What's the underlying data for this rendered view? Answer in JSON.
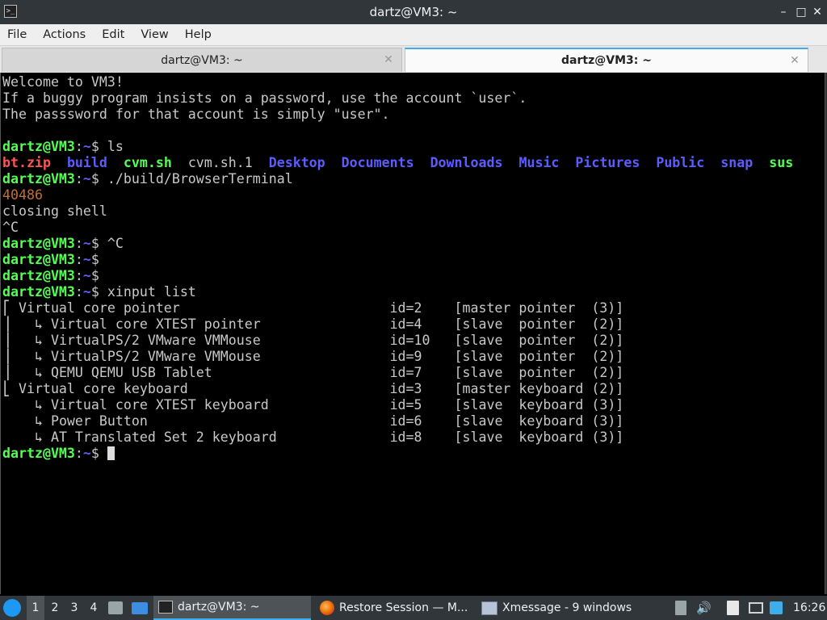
{
  "window": {
    "title": "dartz@VM3: ~",
    "app_icon": "terminal-icon",
    "app_icon_glyph": ">_",
    "minimize_glyph": "–",
    "maximize_glyph": "□",
    "close_glyph": "✕"
  },
  "menu": {
    "file": "File",
    "actions": "Actions",
    "edit": "Edit",
    "view": "View",
    "help": "Help"
  },
  "tabs": [
    {
      "label": "dartz@VM3: ~",
      "active": false,
      "close_glyph": "✕"
    },
    {
      "label": "dartz@VM3: ~",
      "active": true,
      "close_glyph": "✕"
    }
  ],
  "terminal": {
    "prompt_user": "dartz@VM3",
    "prompt_sep": ":",
    "prompt_path": "~",
    "prompt_dollar": "$ ",
    "welcome": [
      "Welcome to VM3!",
      "If a buggy program insists on a password, use the account `user`.",
      "The passsword for that account is simply \"user\"."
    ],
    "cmd_ls": "ls",
    "ls_items": [
      {
        "name": "bt.zip",
        "color": "#ff5454"
      },
      {
        "name": "build",
        "color": "#5c5cff"
      },
      {
        "name": "cvm.sh",
        "color": "#54ff54"
      },
      {
        "name": "cvm.sh.1",
        "color": "#c8c8c8"
      },
      {
        "name": "Desktop",
        "color": "#5c5cff"
      },
      {
        "name": "Documents",
        "color": "#5c5cff"
      },
      {
        "name": "Downloads",
        "color": "#5c5cff"
      },
      {
        "name": "Music",
        "color": "#5c5cff"
      },
      {
        "name": "Pictures",
        "color": "#5c5cff"
      },
      {
        "name": "Public",
        "color": "#5c5cff"
      },
      {
        "name": "snap",
        "color": "#5c5cff"
      },
      {
        "name": "sus",
        "color": "#54ff54"
      }
    ],
    "cmd_browser": "./build/BrowserTerminal",
    "pid": "40486",
    "closing": "closing shell",
    "ctrl_c": "^C",
    "cmd_ctrlc": "^C",
    "cmd_xinput": "xinput list",
    "xinput": [
      {
        "tree": "⎡ ",
        "name": "Virtual core pointer",
        "id": "id=2",
        "desc": "[master pointer  (3)]"
      },
      {
        "tree": "⎥   ↳ ",
        "name": "Virtual core XTEST pointer",
        "id": "id=4",
        "desc": "[slave  pointer  (2)]"
      },
      {
        "tree": "⎥   ↳ ",
        "name": "VirtualPS/2 VMware VMMouse",
        "id": "id=10",
        "desc": "[slave  pointer  (2)]"
      },
      {
        "tree": "⎥   ↳ ",
        "name": "VirtualPS/2 VMware VMMouse",
        "id": "id=9",
        "desc": "[slave  pointer  (2)]"
      },
      {
        "tree": "⎥   ↳ ",
        "name": "QEMU QEMU USB Tablet",
        "id": "id=7",
        "desc": "[slave  pointer  (2)]"
      },
      {
        "tree": "⎣ ",
        "name": "Virtual core keyboard",
        "id": "id=3",
        "desc": "[master keyboard (2)]"
      },
      {
        "tree": "    ↳ ",
        "name": "Virtual core XTEST keyboard",
        "id": "id=5",
        "desc": "[slave  keyboard (3)]"
      },
      {
        "tree": "    ↳ ",
        "name": "Power Button",
        "id": "id=6",
        "desc": "[slave  keyboard (3)]"
      },
      {
        "tree": "    ↳ ",
        "name": "AT Translated Set 2 keyboard",
        "id": "id=8",
        "desc": "[slave  keyboard (3)]"
      }
    ]
  },
  "taskbar": {
    "start_icon": "start-menu-icon",
    "workspaces": [
      "1",
      "2",
      "3",
      "4"
    ],
    "active_workspace": "1",
    "tasks": [
      {
        "label": "dartz@VM3: ~",
        "icon": "terminal-icon",
        "active": true
      },
      {
        "label": "Restore Session — M...",
        "icon": "firefox-icon",
        "active": false
      },
      {
        "label": "Xmessage - 9 windows",
        "icon": "xmessage-icon",
        "active": false
      }
    ],
    "tray_icons": [
      "trash-icon",
      "volume-icon",
      "clipboard-icon",
      "network-icon",
      "update-icon"
    ],
    "volume_glyph": "🔊",
    "clock": "16:26"
  },
  "colors": {
    "prompt_user": "#54ff54",
    "prompt_path": "#5c5cff",
    "pid": "#c46e34",
    "accent": "#3daee9"
  }
}
